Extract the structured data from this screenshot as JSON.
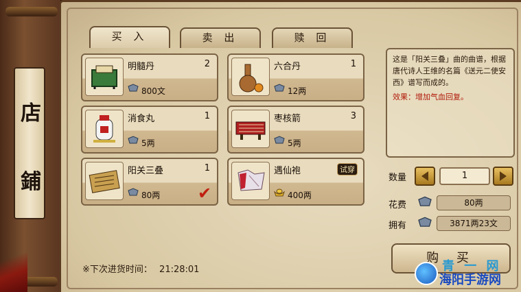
{
  "banner": {
    "chars": [
      "店",
      "鋪"
    ]
  },
  "tabs": [
    {
      "label": "买 入",
      "active": true
    },
    {
      "label": "卖 出",
      "active": false
    },
    {
      "label": "赎 回",
      "active": false
    }
  ],
  "items": [
    {
      "name": "明髓丹",
      "qty": "2",
      "price": "800文",
      "icon": "mahjong-box-icon"
    },
    {
      "name": "六合丹",
      "qty": "1",
      "price": "12两",
      "icon": "gourd-bottle-icon"
    },
    {
      "name": "消食丸",
      "qty": "1",
      "price": "5两",
      "icon": "medicine-jar-icon"
    },
    {
      "name": "枣核箭",
      "qty": "3",
      "price": "5两",
      "icon": "arrow-bundle-icon"
    },
    {
      "name": "阳关三叠",
      "qty": "1",
      "price": "80两",
      "icon": "music-scroll-icon",
      "selected": true
    },
    {
      "name": "遇仙袍",
      "qty": "",
      "price": "400两",
      "icon": "robe-icon",
      "badge": "试穿",
      "currency": "gold-ingot"
    }
  ],
  "restock": {
    "label": "※下次进货时间：",
    "time": "21:28:01"
  },
  "detail": {
    "description": "这是「阳关三叠」曲的曲谱，根据唐代诗人王维的名篇《送元二使安西》谱写而成的。",
    "effect": "效果：增加气血回复。"
  },
  "purchase": {
    "qty_label": "数量",
    "qty_value": "1",
    "cost_label": "花费",
    "cost_value": "80两",
    "owned_label": "拥有",
    "owned_value": "3871两23文",
    "buy_label": "购 买"
  },
  "watermark": {
    "top": "青 一 网",
    "main": "海阳手游网"
  },
  "colors": {
    "effect_red": "#b01a0a",
    "check_red": "#c02010",
    "parchment": "#e8dcc0"
  }
}
